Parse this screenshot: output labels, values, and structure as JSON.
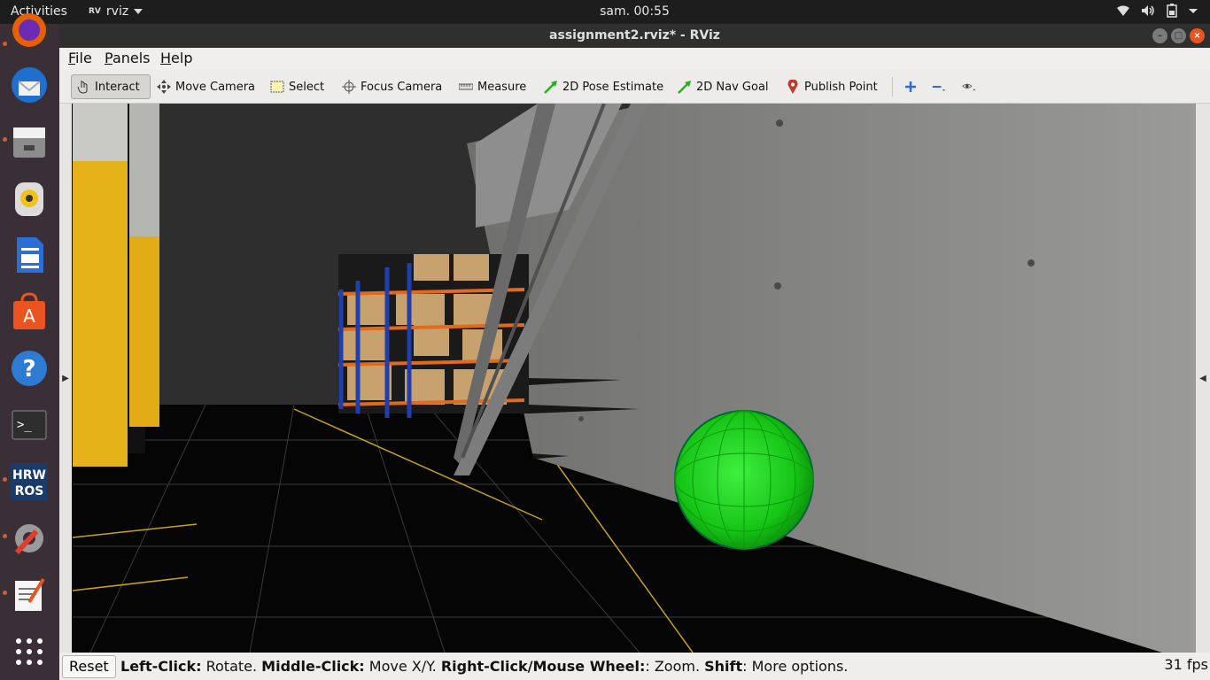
{
  "topbar": {
    "activities": "Activities",
    "app_name": "rviz",
    "app_icon_text": "RV",
    "clock": "sam. 00:55",
    "tray": {
      "wifi": "wifi-icon",
      "sound": "speaker-icon",
      "battery": "battery-icon",
      "menu": "chevron-down-icon"
    }
  },
  "dock": {
    "items": [
      {
        "name": "firefox",
        "icon": "firefox-icon"
      },
      {
        "name": "thunderbird",
        "icon": "thunderbird-icon"
      },
      {
        "name": "files",
        "icon": "files-icon"
      },
      {
        "name": "rhythmbox",
        "icon": "rhythmbox-icon"
      },
      {
        "name": "writer",
        "icon": "libreoffice-writer-icon"
      },
      {
        "name": "software",
        "icon": "ubuntu-software-icon"
      },
      {
        "name": "help",
        "icon": "help-icon",
        "glyph": "?"
      },
      {
        "name": "terminal",
        "icon": "terminal-icon",
        "glyph": ">_"
      },
      {
        "name": "hrwros",
        "icon": "hrwros-icon",
        "line1": "HRW",
        "line2": "ROS"
      },
      {
        "name": "system-tools",
        "icon": "settings-tools-icon"
      },
      {
        "name": "text-editor",
        "icon": "text-editor-icon"
      },
      {
        "name": "app-grid",
        "icon": "app-grid-icon"
      }
    ]
  },
  "window": {
    "title": "assignment2.rviz* - RViz",
    "buttons": {
      "minimize": "–",
      "maximize": "□",
      "close": "×"
    }
  },
  "menubar": {
    "file": {
      "u": "F",
      "rest": "ile"
    },
    "panels": {
      "u": "P",
      "rest": "anels"
    },
    "help": {
      "u": "H",
      "rest": "elp"
    }
  },
  "toolbar": {
    "interact": "Interact",
    "move_camera": "Move Camera",
    "select": "Select",
    "focus_camera": "Focus Camera",
    "measure": "Measure",
    "pose_estimate": "2D Pose Estimate",
    "nav_goal": "2D Nav Goal",
    "publish_point": "Publish Point",
    "add_icon": "plus-icon",
    "remove_icon": "minus-icon",
    "view_icon": "eye-icon"
  },
  "statusbar": {
    "reset": "Reset",
    "hint_left": "Left-Click:",
    "hint_left_action": " Rotate. ",
    "hint_middle": "Middle-Click:",
    "hint_middle_action": " Move X/Y. ",
    "hint_right": "Right-Click/Mouse Wheel:",
    "hint_right_action": ": Zoom. ",
    "hint_shift": "Shift",
    "hint_shift_action": ": More options.",
    "fps": "31 fps"
  },
  "scene": {
    "sphere_color": "#1fd11f",
    "wall_color": "#8a8a88",
    "floor_color": "#050505",
    "pillar_color": "#e6b219"
  }
}
